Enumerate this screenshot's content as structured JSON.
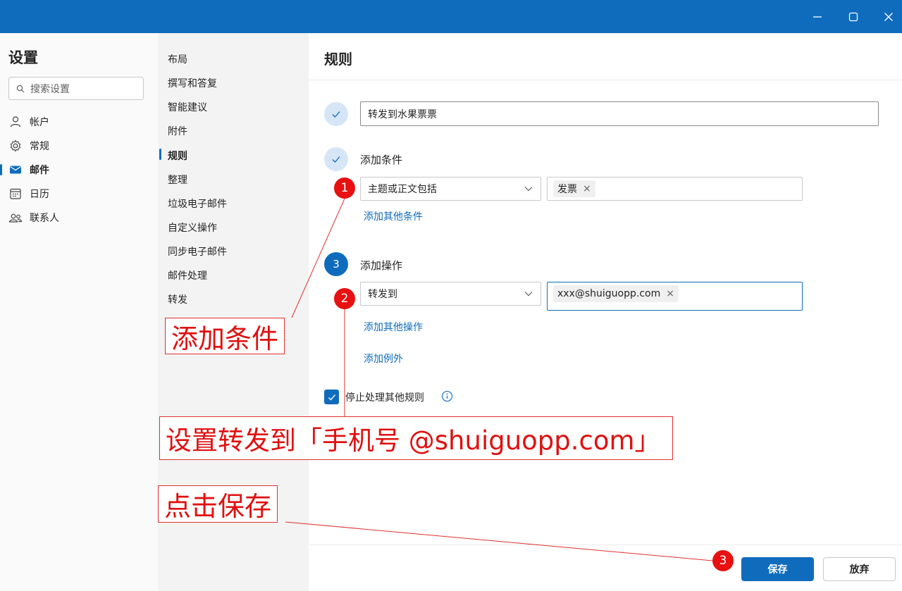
{
  "window": {
    "minimize_icon": "minimize-icon",
    "maximize_icon": "maximize-icon",
    "close_icon": "close-icon",
    "titlebar_color": "#0f6cbd"
  },
  "sidebar": {
    "title": "设置",
    "search_placeholder": "搜索设置",
    "items": [
      {
        "label": "帐户",
        "icon": "person-icon"
      },
      {
        "label": "常规",
        "icon": "gear-icon"
      },
      {
        "label": "邮件",
        "icon": "mail-icon",
        "active": true
      },
      {
        "label": "日历",
        "icon": "calendar-icon"
      },
      {
        "label": "联系人",
        "icon": "people-icon"
      }
    ]
  },
  "subnav": {
    "items": [
      "布局",
      "撰写和答复",
      "智能建议",
      "附件",
      "规则",
      "整理",
      "垃圾电子邮件",
      "自定义操作",
      "同步电子邮件",
      "邮件处理",
      "转发"
    ],
    "active": "规则"
  },
  "main": {
    "title": "规则",
    "rule_name": "转发到水果票票",
    "condition": {
      "heading": "添加条件",
      "dropdown_value": "主题或正文包括",
      "chip": "发票",
      "add_link": "添加其他条件"
    },
    "action": {
      "step_number": "3",
      "heading": "添加操作",
      "dropdown_value": "转发到",
      "chip": "xxx@shuiguopp.com",
      "add_link": "添加其他操作",
      "exception_link": "添加例外"
    },
    "stop_processing": {
      "label": "停止处理其他规则",
      "checked": true
    },
    "save_label": "保存",
    "discard_label": "放弃"
  },
  "annotations": {
    "badge1": "1",
    "badge2": "2",
    "badge3": "3",
    "note1": "添加条件",
    "note2": "设置转发到「手机号 @shuiguopp.com」",
    "note3": "点击保存",
    "color": "#e81010"
  },
  "colors": {
    "accent": "#0f6cbd"
  }
}
